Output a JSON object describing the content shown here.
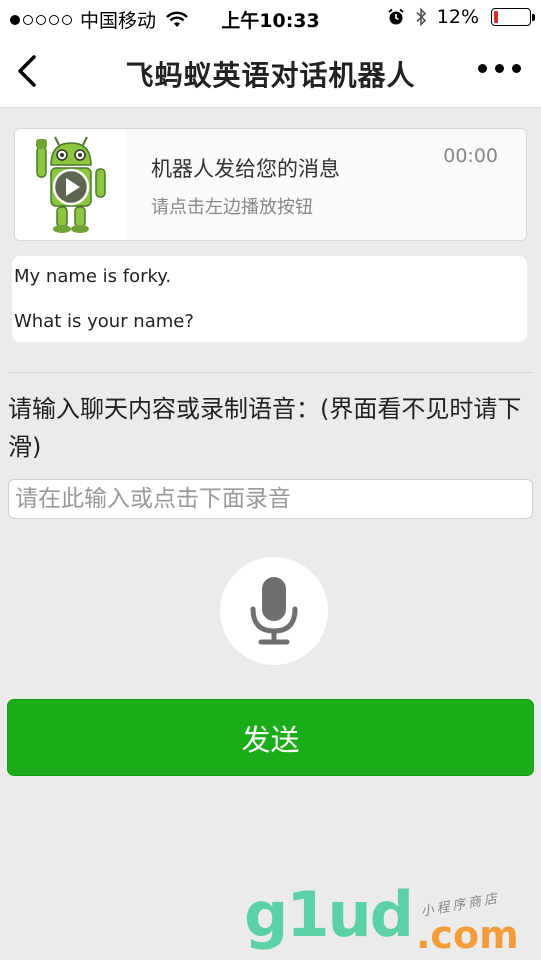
{
  "status_bar": {
    "carrier": "中国移动",
    "time": "上午10:33",
    "battery": "12%",
    "battery_level": 0.12,
    "signal_dots_filled": 1,
    "signal_dots_total": 5
  },
  "nav": {
    "title": "飞蚂蚁英语对话机器人"
  },
  "message_card": {
    "title": "机器人发给您的消息",
    "subtitle": "请点击左边播放按钮",
    "duration": "00:00"
  },
  "text_box": {
    "line1": "My name is forky.",
    "line2": "What is your name?"
  },
  "prompt": {
    "text": "请输入聊天内容或录制语音：(界面看不见时请下滑)"
  },
  "input": {
    "value": "",
    "placeholder": "请在此输入或点击下面录音"
  },
  "send_button": {
    "label": "发送"
  },
  "watermark": {
    "brand": "g1ud",
    "domain": ".com",
    "tagline": "小程序商店"
  },
  "colors": {
    "primary_green": "#1aad19",
    "battery_low": "#e02b2b",
    "watermark_teal": "#5dd1a6",
    "watermark_orange": "#f39c3a"
  },
  "icons": [
    "back-chevron-icon",
    "more-dots-icon",
    "wifi-icon",
    "alarm-icon",
    "bluetooth-icon",
    "battery-icon",
    "robot-thumbnail",
    "play-icon",
    "microphone-icon"
  ]
}
